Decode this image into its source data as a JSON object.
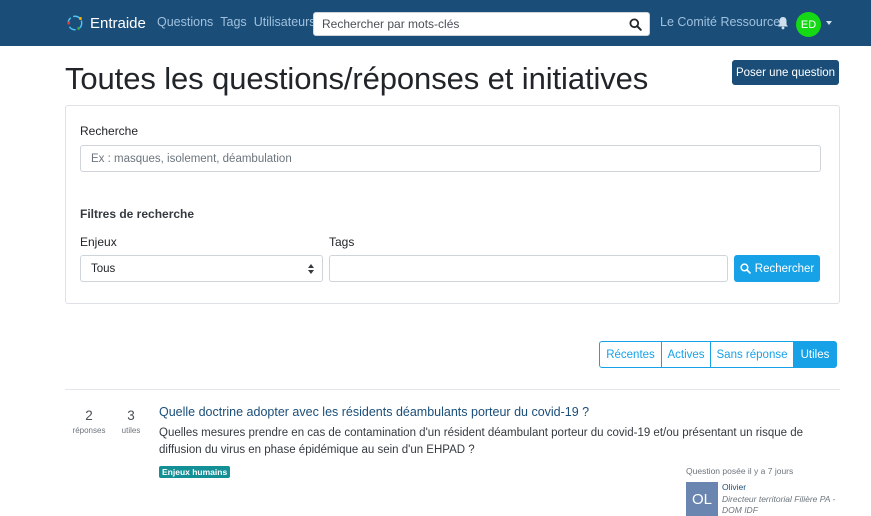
{
  "navbar": {
    "brand": "Entraide",
    "links": [
      "Questions",
      "Tags",
      "Utilisateurs"
    ],
    "search_placeholder": "Rechercher par mots-clés",
    "search_icon": "magnifier-icon",
    "org_name": "Le Comité Ressources",
    "bell_icon": "bell-icon",
    "avatar_initials": "ED",
    "avatar_color": "#16d916",
    "bar_color": "#1a4e79"
  },
  "header": {
    "title": "Toutes les questions/réponses et initiatives",
    "ask_button": "Poser une question"
  },
  "search_card": {
    "search_label": "Recherche",
    "search_placeholder": "Ex : masques, isolement, déambulation",
    "filters_title": "Filtres de recherche",
    "enjeux_label": "Enjeux",
    "enjeux_selected": "Tous",
    "tags_label": "Tags",
    "tags_value": "",
    "submit_label": "Rechercher",
    "accent_color": "#17a2e8"
  },
  "tabs": [
    {
      "label": "Récentes",
      "active": false
    },
    {
      "label": "Actives",
      "active": false
    },
    {
      "label": "Sans réponse",
      "active": false
    },
    {
      "label": "Utiles",
      "active": true
    }
  ],
  "questions": [
    {
      "answers_count": "2",
      "answers_label": "réponses",
      "useful_count": "3",
      "useful_label": "utiles",
      "title": "Quelle doctrine adopter avec les résidents déambulants porteur du covid-19 ?",
      "excerpt": "Quelles mesures prendre en cas de contamination d'un résident déambulant porteur du covid-19 et/ou présentant un risque de diffusion du virus en phase épidémique au sein d'un EHPAD ?",
      "tag": "Enjeux humains",
      "asked": "Question posée il y a 7 jours",
      "author_initials": "OL",
      "author_name": "Olivier",
      "author_role": "Directeur territorial Filière PA - DOM IDF"
    }
  ]
}
